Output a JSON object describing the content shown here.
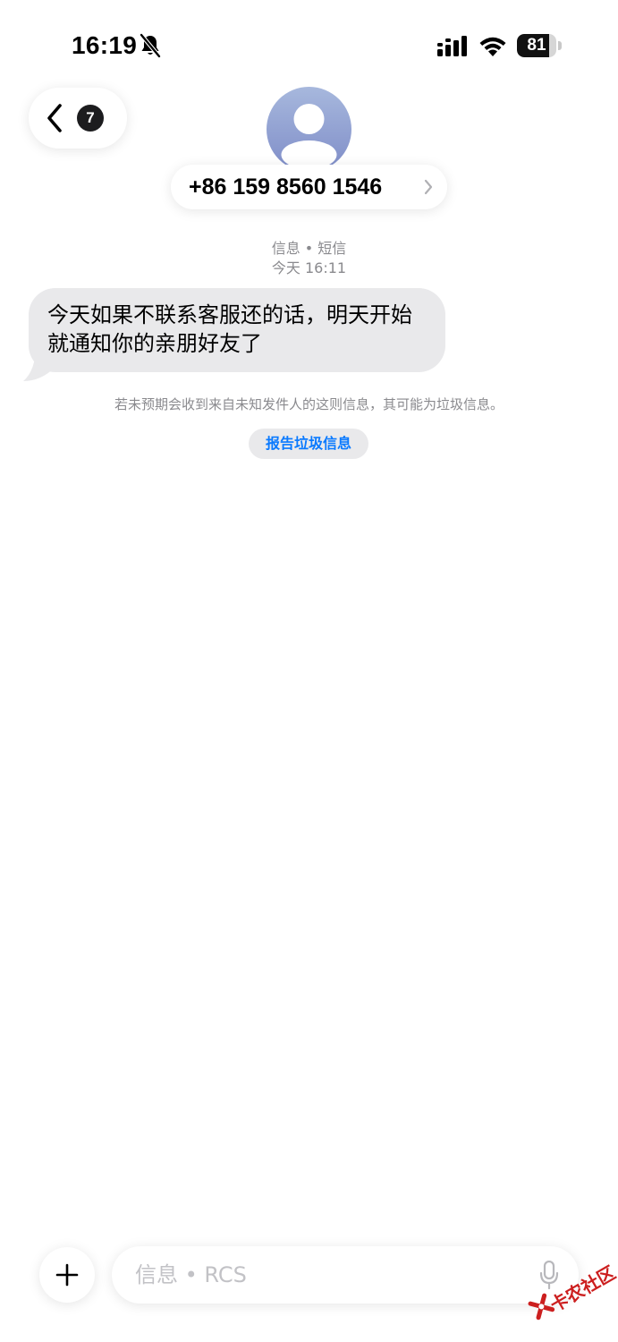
{
  "status_bar": {
    "time": "16:19",
    "battery_level": "81",
    "icons": [
      "bell-slash-icon",
      "cellular-icon",
      "wifi-icon",
      "battery-icon"
    ]
  },
  "nav": {
    "back_badge": "7"
  },
  "contact": {
    "name": "+86 159 8560 1546"
  },
  "meta": {
    "service": "信息 • 短信",
    "timestamp": "今天 16:11"
  },
  "messages": [
    {
      "direction": "incoming",
      "text": "今天如果不联系客服还的话，明天开始就通知你的亲朋好友了"
    }
  ],
  "junk_notice": "若未预期会收到来自未知发件人的这则信息，其可能为垃圾信息。",
  "report_label": "报告垃圾信息",
  "compose": {
    "placeholder": "信息 • RCS"
  },
  "watermark": {
    "text": "卡农社区"
  },
  "colors": {
    "bubble_incoming": "#e9e9eb",
    "link_blue": "#0a7aff",
    "meta_gray": "#8a8a8e",
    "avatar_top": "#a7b8dd",
    "avatar_bottom": "#7f8dc8"
  }
}
